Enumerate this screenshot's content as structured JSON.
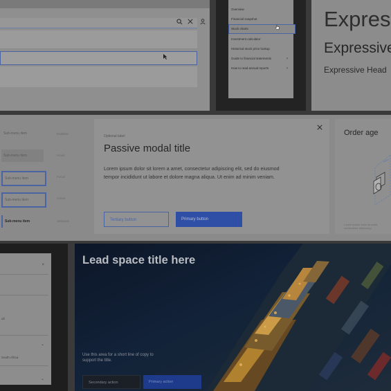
{
  "header_panel": {
    "icons": [
      "search-icon",
      "close-icon",
      "user-icon"
    ]
  },
  "phone_menu": {
    "items": [
      {
        "label": "Overview",
        "chevron": false
      },
      {
        "label": "Financial snapshot",
        "chevron": false
      },
      {
        "label": "Stock charts",
        "chevron": false,
        "selected": true
      },
      {
        "label": "Investment calculator",
        "chevron": false
      },
      {
        "label": "Historical stock price lookup",
        "chevron": false
      },
      {
        "label": "Guide to financial statements",
        "chevron": true
      },
      {
        "label": "How to read annual reports",
        "chevron": true
      }
    ]
  },
  "expressive": {
    "heading_1": "Expres",
    "heading_2": "Expressive",
    "heading_3": "Expressive Head"
  },
  "submenu": {
    "items": [
      {
        "label": "Sub-menu item",
        "meta": "Enabled"
      },
      {
        "label": "Sub-menu item",
        "meta": "Hover"
      },
      {
        "label": "Sub-menu item",
        "meta": "Focus"
      },
      {
        "label": "Sub-menu item",
        "meta": "Active"
      },
      {
        "label": "Sub-menu item",
        "meta": "Selected"
      }
    ]
  },
  "modal": {
    "optional_label": "Optional label",
    "title": "Passive modal title",
    "body": "Lorem ipsum dolor sit lorem a amet, consectetur adipiscing elit, sed do eiusmod tempor incididunt ut labore et dolore magna aliqua. Ut enim ad minim veniam.",
    "tertiary_button": "Tertiary button",
    "primary_button": "Primary button",
    "close_icon": "close-icon"
  },
  "order_card": {
    "title": "Order age",
    "caption": "Lorem ipsum dolor sit amet consectetur adipiscing"
  },
  "side_card": {
    "items": [
      "ult",
      "",
      "",
      "South Africa"
    ]
  },
  "lead_space": {
    "title": "Lead space title here",
    "copy": "Use this area for a short line of copy to support the title.",
    "secondary_button": "Secondary action",
    "primary_button": "Primary action"
  },
  "colors": {
    "accent_blue": "#2f4ea6",
    "focus_border": "#4a63a3",
    "dark_bg": "#232323"
  }
}
